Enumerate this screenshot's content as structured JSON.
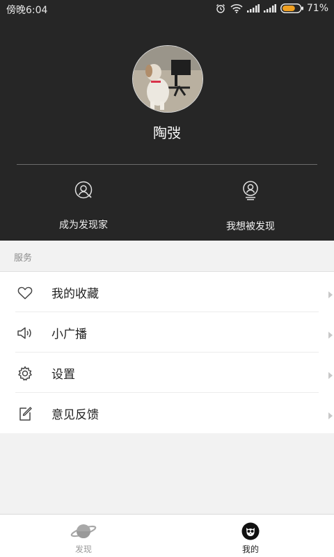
{
  "status_bar": {
    "time": "傍晚6:04",
    "battery": "71%",
    "battery_level": 0.71
  },
  "profile": {
    "username": "陶弢",
    "avatar_icon": "dog-photo"
  },
  "actions": [
    {
      "label": "成为发现家",
      "icon": "user-circle-icon"
    },
    {
      "label": "我想被发现",
      "icon": "user-badge-icon"
    }
  ],
  "section": {
    "title": "服务"
  },
  "menu": [
    {
      "label": "我的收藏",
      "icon": "heart-icon"
    },
    {
      "label": "小广播",
      "icon": "speaker-icon"
    },
    {
      "label": "设置",
      "icon": "gear-icon"
    },
    {
      "label": "意见反馈",
      "icon": "edit-icon"
    }
  ],
  "tabs": [
    {
      "label": "发现",
      "icon": "planet-icon",
      "active": false
    },
    {
      "label": "我的",
      "icon": "owl-icon",
      "active": true
    }
  ],
  "colors": {
    "header_bg": "#262626",
    "battery_fill": "#f0a020",
    "tab_inactive": "#9a9a9a",
    "tab_active": "#222222"
  }
}
